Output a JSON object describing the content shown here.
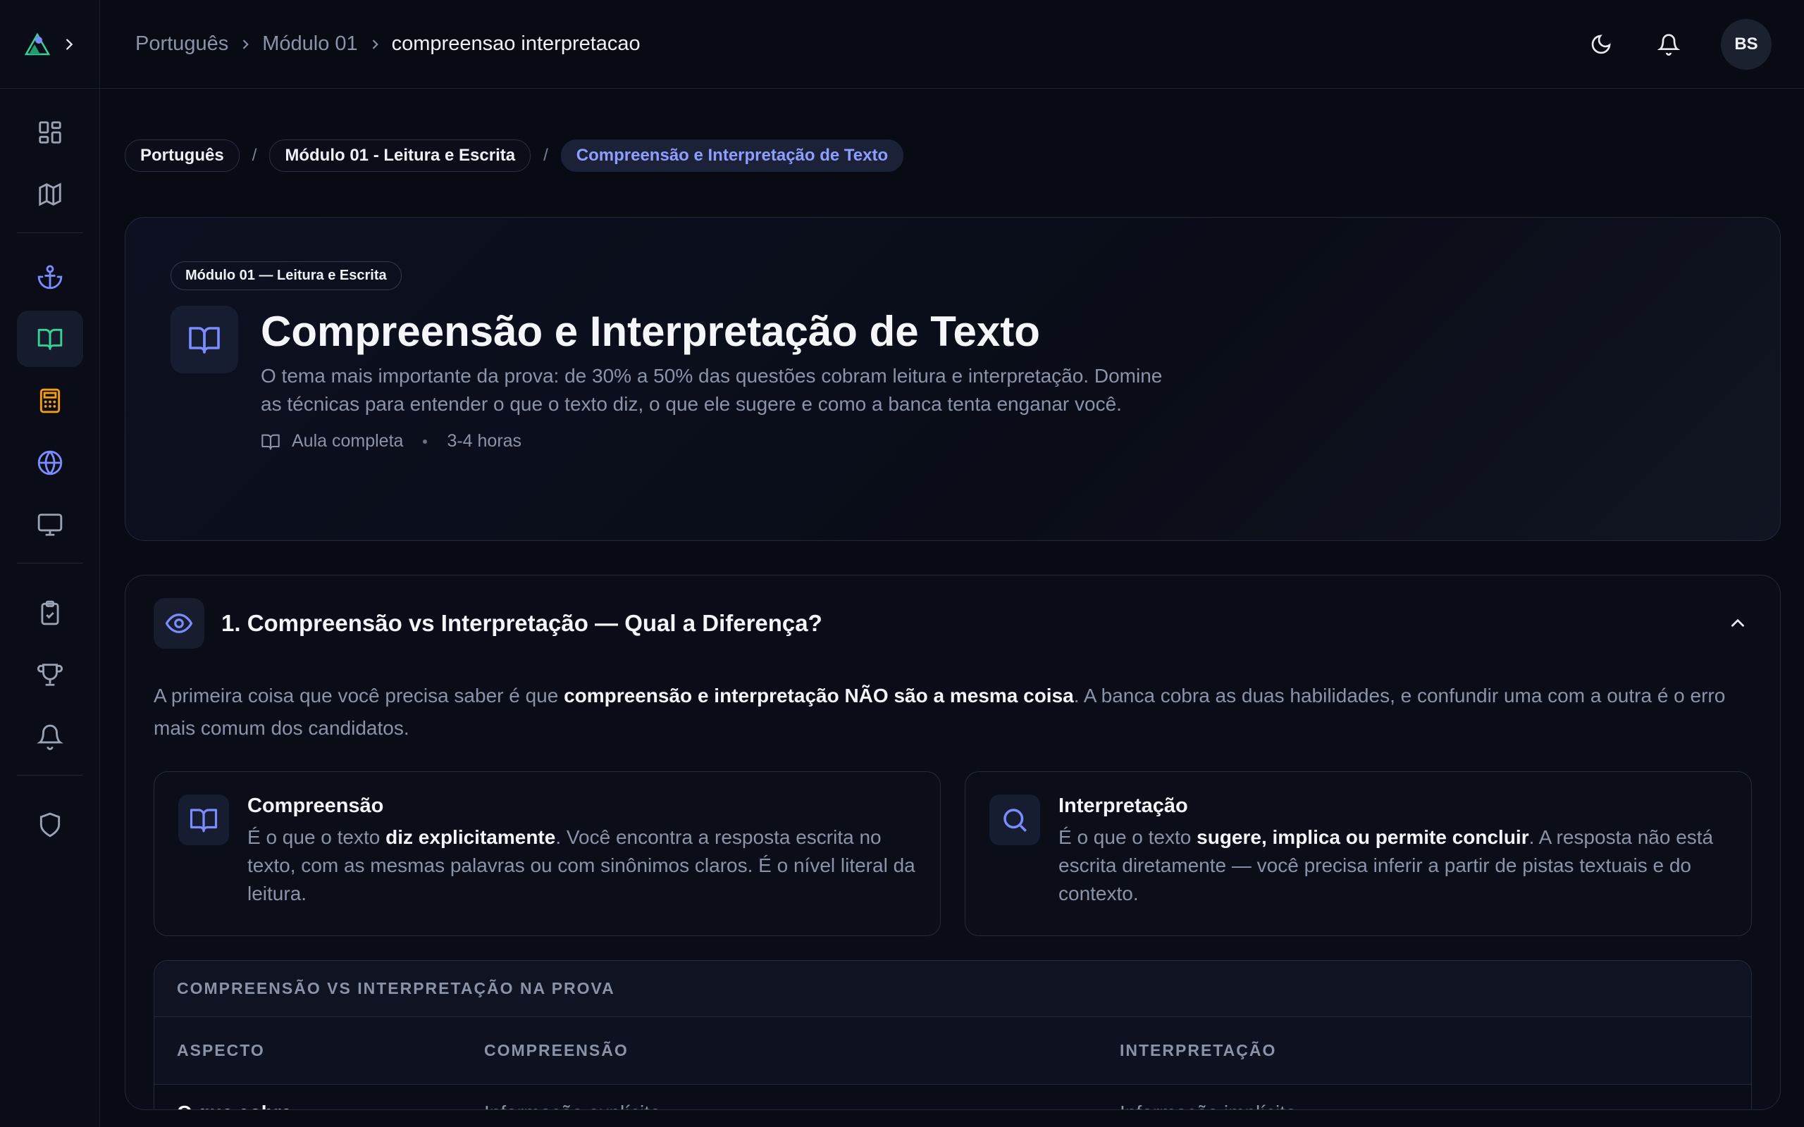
{
  "topbar": {
    "crumbs": [
      "Português",
      "Módulo 01",
      "compreensao interpretacao"
    ],
    "avatar": "BS"
  },
  "breadcrumb_pills": [
    "Português",
    "Módulo 01 - Leitura e Escrita",
    "Compreensão e Interpretação de Texto"
  ],
  "hero": {
    "tag": "Módulo 01 — Leitura e Escrita",
    "title": "Compreensão e Interpretação de Texto",
    "description": "O tema mais importante da prova: de 30% a 50% das questões cobram leitura e interpretação. Domine as técnicas para entender o que o texto diz, o que ele sugere e como a banca tenta enganar você.",
    "meta_lesson": "Aula completa",
    "meta_duration": "3-4 horas"
  },
  "section": {
    "title": "1. Compreensão vs Interpretação — Qual a Diferença?",
    "intro_before": "A primeira coisa que você precisa saber é que ",
    "intro_bold": "compreensão e interpretação NÃO são a mesma coisa",
    "intro_after": ". A banca cobra as duas habilidades, e confundir uma com a outra é o erro mais comum dos candidatos.",
    "cards": [
      {
        "title": "Compreensão",
        "text_before": "É o que o texto ",
        "text_bold": "diz explicitamente",
        "text_after": ". Você encontra a resposta escrita no texto, com as mesmas palavras ou com sinônimos claros. É o nível literal da leitura."
      },
      {
        "title": "Interpretação",
        "text_before": "É o que o texto ",
        "text_bold": "sugere, implica ou permite concluir",
        "text_after": ". A resposta não está escrita diretamente — você precisa inferir a partir de pistas textuais e do contexto."
      }
    ],
    "table": {
      "caption": "COMPREENSÃO VS INTERPRETAÇÃO NA PROVA",
      "headers": [
        "ASPECTO",
        "COMPREENSÃO",
        "INTERPRETAÇÃO"
      ],
      "rows": [
        [
          "O que cobra",
          "Informação explícita",
          "Informação implícita"
        ]
      ]
    }
  },
  "colors": {
    "accent_blue": "#7b8cff",
    "accent_green": "#34d399",
    "accent_amber": "#f59e0b",
    "background": "#080b14"
  }
}
